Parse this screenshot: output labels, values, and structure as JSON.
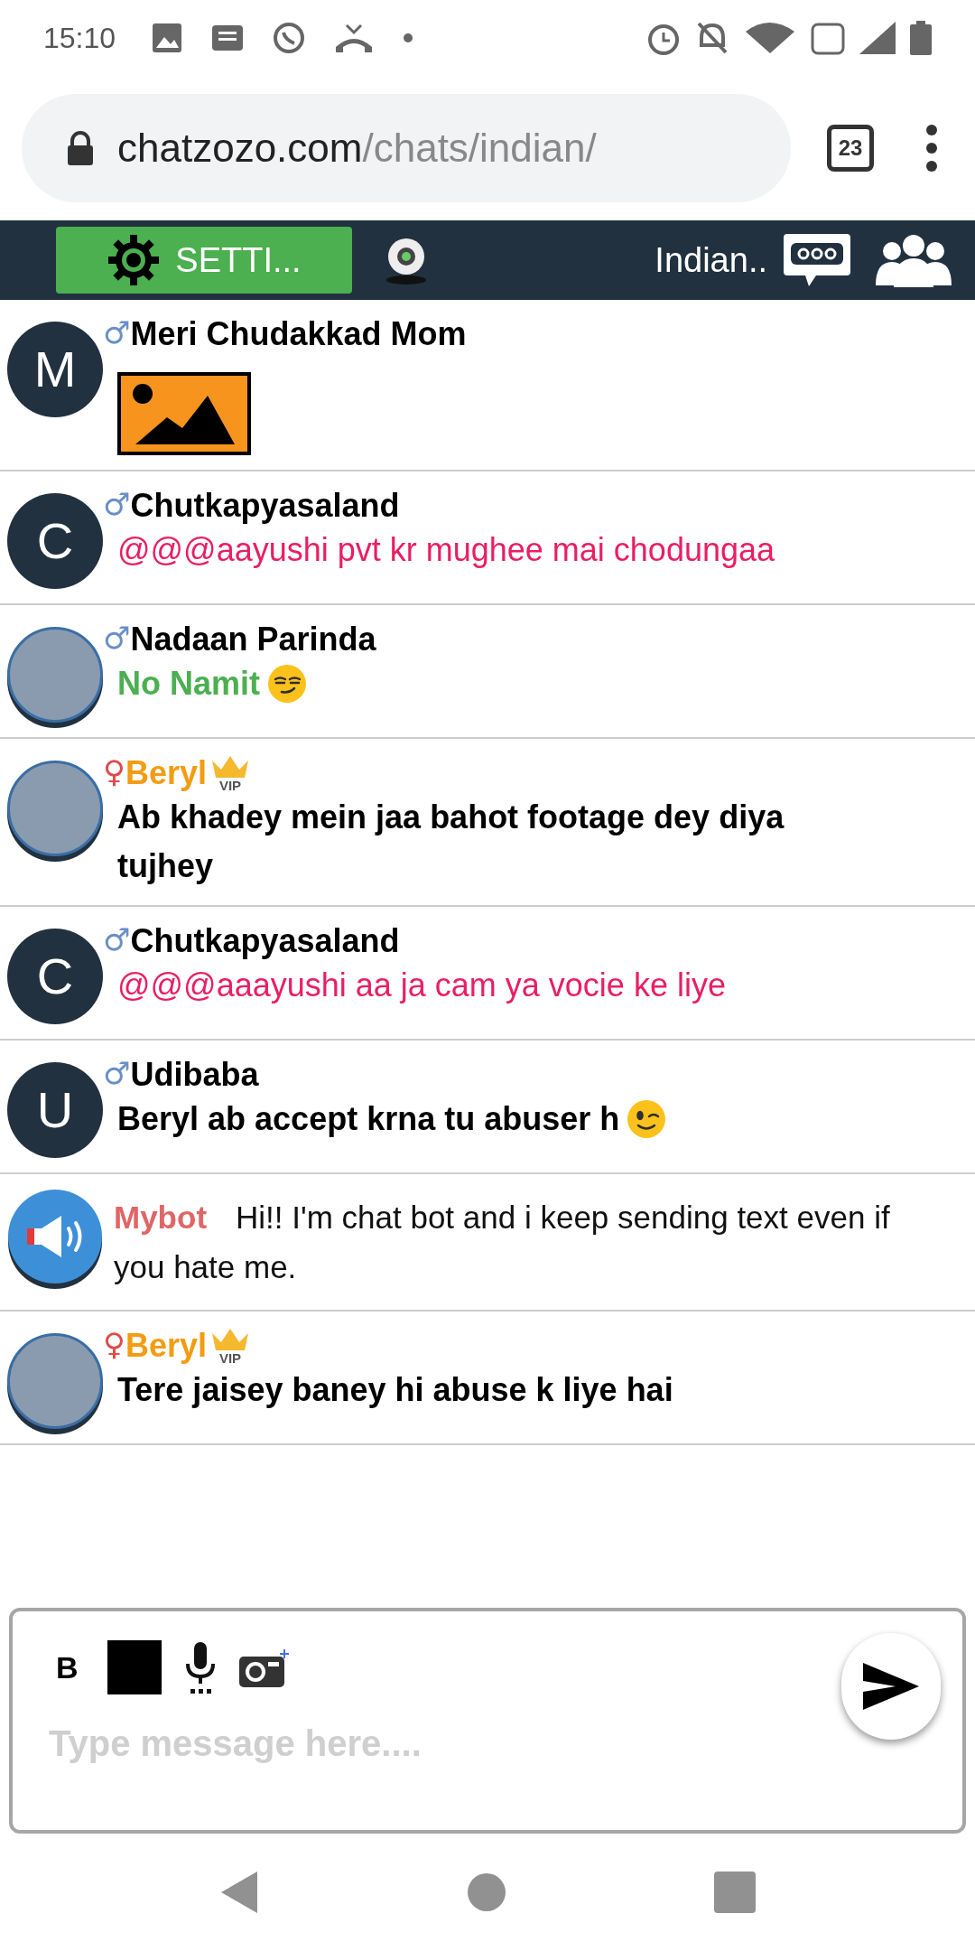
{
  "status_bar": {
    "time": "15:10"
  },
  "browser": {
    "url_host": "chatzozo.com",
    "url_path": "/chats/indian/",
    "tab_count": "23"
  },
  "header": {
    "settings_label": "SETTI...",
    "room_name": "Indian.."
  },
  "messages": [
    {
      "kind": "image",
      "avatar": {
        "kind": "letter",
        "letter": "M"
      },
      "gender": {
        "symbol": "♂",
        "color": "#6a8fc8"
      },
      "name": {
        "text": "Meri Chudakkad Mom",
        "color": "#000000"
      }
    },
    {
      "kind": "text",
      "avatar": {
        "kind": "letter",
        "letter": "C"
      },
      "gender": {
        "symbol": "♂",
        "color": "#6a8fc8"
      },
      "name": {
        "text": "Chutkapyasaland",
        "color": "#000000"
      },
      "message": {
        "text": "@@@aayushi pvt kr mughee mai chodungaa",
        "color": "#e91e63",
        "bold": false
      }
    },
    {
      "kind": "text",
      "avatar": {
        "kind": "photo"
      },
      "gender": {
        "symbol": "♂",
        "color": "#6a8fc8"
      },
      "name": {
        "text": "Nadaan Parinda",
        "color": "#000000"
      },
      "message": {
        "text": "No Namit",
        "color": "#4caf50",
        "bold": true
      },
      "emoji": {
        "kind": "smirk"
      }
    },
    {
      "kind": "text",
      "avatar": {
        "kind": "photo"
      },
      "gender": {
        "symbol": "♀",
        "color": "#e04a4a"
      },
      "name": {
        "text": "Beryl",
        "color": "#f39c12"
      },
      "badge": "VIP",
      "message": {
        "text": "Ab khadey mein jaa bahot footage dey diya tujhey",
        "color": "#000000",
        "bold": true
      }
    },
    {
      "kind": "text",
      "avatar": {
        "kind": "letter",
        "letter": "C"
      },
      "gender": {
        "symbol": "♂",
        "color": "#6a8fc8"
      },
      "name": {
        "text": "Chutkapyasaland",
        "color": "#000000"
      },
      "message": {
        "text": "@@@aaayushi aa ja cam ya vocie ke liye",
        "color": "#e91e63",
        "bold": false
      }
    },
    {
      "kind": "text",
      "avatar": {
        "kind": "letter",
        "letter": "U"
      },
      "gender": {
        "symbol": "♂",
        "color": "#6a8fc8"
      },
      "name": {
        "text": "Udibaba",
        "color": "#000000"
      },
      "message": {
        "text": "Beryl ab accept krna tu abuser h",
        "color": "#000000",
        "bold": true
      },
      "emoji": {
        "kind": "wink"
      }
    },
    {
      "kind": "bot",
      "avatar": {
        "kind": "bot"
      },
      "name": {
        "text": "Mybot",
        "color": "#e06666"
      },
      "message": {
        "text": "Hi!! I'm chat bot and i keep sending text even if you hate me.",
        "color": "#111111",
        "bold": false
      }
    },
    {
      "kind": "text",
      "avatar": {
        "kind": "photo"
      },
      "gender": {
        "symbol": "♀",
        "color": "#e04a4a"
      },
      "name": {
        "text": "Beryl",
        "color": "#f39c12"
      },
      "badge": "VIP",
      "message": {
        "text": "Tere jaisey baney hi abuse k liye hai",
        "color": "#000000",
        "bold": true
      }
    }
  ],
  "composer": {
    "bold_label": "B",
    "placeholder": "Type message here...."
  }
}
